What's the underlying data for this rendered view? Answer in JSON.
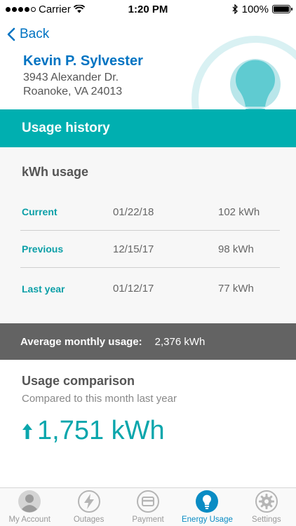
{
  "status_bar": {
    "carrier": "Carrier",
    "time": "1:20 PM",
    "battery": "100%",
    "battery_level": 1.0
  },
  "header": {
    "back_label": "Back",
    "name": "Kevin P. Sylvester",
    "address_line1": "3943 Alexander Dr.",
    "address_line2": "Roanoke, VA 24013"
  },
  "section": {
    "title": "Usage history"
  },
  "kwh": {
    "title": "kWh usage",
    "rows": [
      {
        "label": "Current",
        "date": "01/22/18",
        "value": "102 kWh"
      },
      {
        "label": "Previous",
        "date": "12/15/17",
        "value": "98 kWh"
      },
      {
        "label": "Last year",
        "date": "01/12/17",
        "value": "77 kWh"
      }
    ]
  },
  "average": {
    "label": "Average monthly usage:",
    "value": "2,376 kWh"
  },
  "comparison": {
    "title": "Usage comparison",
    "subtitle": "Compared to this month last year",
    "value": "1,751 kWh",
    "direction_icon": "arrow-up-icon"
  },
  "tabs": [
    {
      "label": "My Account",
      "icon": "person-icon",
      "active": false
    },
    {
      "label": "Outages",
      "icon": "lightning-icon",
      "active": false
    },
    {
      "label": "Payment",
      "icon": "payment-icon",
      "active": false
    },
    {
      "label": "Energy Usage",
      "icon": "lightbulb-icon",
      "active": true
    },
    {
      "label": "Settings",
      "icon": "gear-icon",
      "active": false
    }
  ],
  "colors": {
    "brand_blue": "#0073c2",
    "teal": "#00afb0",
    "gray_bar": "#636363",
    "active_tab": "#0a8cc4"
  }
}
